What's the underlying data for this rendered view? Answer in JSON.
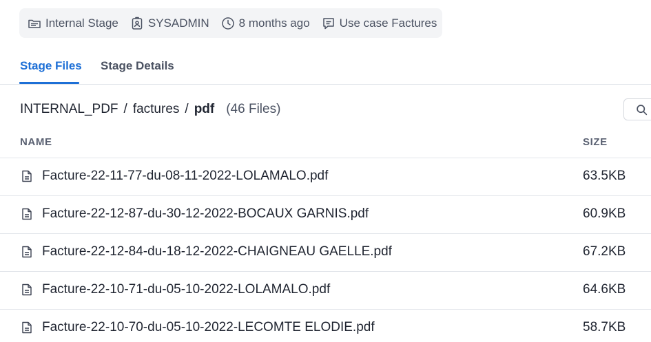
{
  "meta": {
    "stage_type": "Internal Stage",
    "owner": "SYSADMIN",
    "modified": "8 months ago",
    "comment": "Use case Factures"
  },
  "tabs": [
    {
      "label": "Stage Files",
      "active": true
    },
    {
      "label": "Stage Details",
      "active": false
    }
  ],
  "breadcrumb": {
    "parts": [
      "INTERNAL_PDF",
      "factures"
    ],
    "current": "pdf",
    "count": "(46 Files)"
  },
  "table": {
    "columns": {
      "name": "NAME",
      "size": "SIZE"
    },
    "rows": [
      {
        "name": "Facture-22-11-77-du-08-11-2022-LOLAMALO.pdf",
        "size": "63.5KB"
      },
      {
        "name": "Facture-22-12-87-du-30-12-2022-BOCAUX GARNIS.pdf",
        "size": "60.9KB"
      },
      {
        "name": "Facture-22-12-84-du-18-12-2022-CHAIGNEAU GAELLE.pdf",
        "size": "67.2KB"
      },
      {
        "name": "Facture-22-10-71-du-05-10-2022-LOLAMALO.pdf",
        "size": "64.6KB"
      },
      {
        "name": "Facture-22-10-70-du-05-10-2022-LECOMTE ELODIE.pdf",
        "size": "58.7KB"
      }
    ]
  },
  "icons": {
    "stage": "stage-icon",
    "owner": "user-badge-icon",
    "time": "clock-icon",
    "comment": "comment-icon",
    "search": "search-icon",
    "file": "file-icon"
  },
  "colors": {
    "accent": "#1d6fd6",
    "meta_bg": "#f3f4f6",
    "text": "#1f2430",
    "muted": "#4b5262"
  }
}
